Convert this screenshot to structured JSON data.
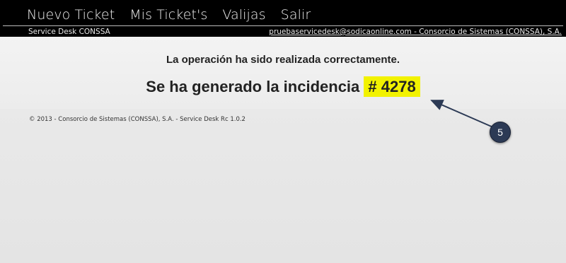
{
  "nav": {
    "items": [
      "Nuevo Ticket",
      "Mis Ticket's",
      "Valijas",
      "Salir"
    ],
    "brand": "Service Desk CONSSA",
    "user": "pruebaservicedesk@sodicaonline.com - Consorcio de Sistemas (CONSSA), S.A."
  },
  "main": {
    "message": "La operación ha sido realizada correctamente.",
    "incident_prefix": "Se ha generado la incidencia",
    "incident_number": "# 4278"
  },
  "footer": {
    "text": "© 2013 - Consorcio de Sistemas (CONSSA), S.A. - Service Desk Rc 1.0.2"
  },
  "annotation": {
    "step": "5",
    "color": "#2c3a55"
  },
  "colors": {
    "navbar": "#000000",
    "highlight": "#f2f200"
  }
}
